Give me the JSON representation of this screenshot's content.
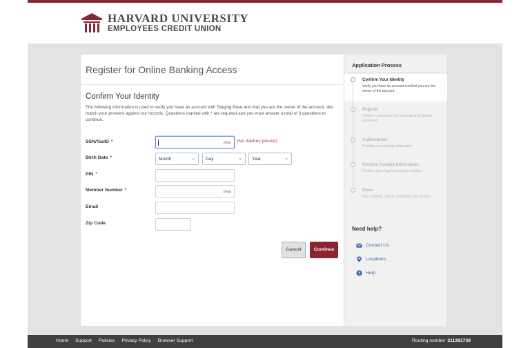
{
  "brand": {
    "line1": "HARVARD UNIVERSITY",
    "line2": "EMPLOYEES CREDIT UNION",
    "accent": "#8c2432"
  },
  "form": {
    "title": "Register for Online Banking Access",
    "section_title": "Confirm Your Identity",
    "intro": "The following information is used to verify you have an account with Staging Base and that you are the owner of the account. We match your answers against our records. Questions marked with * are required and you must answer a total of 3 questions to continue.",
    "ssn_label": "SSN/TaxID",
    "ssn_hint": "(No dashes please)",
    "birth_label": "Birth Date",
    "month": "Month",
    "day": "Day",
    "year": "Year",
    "pin_label": "PIN",
    "member_label": "Member Number",
    "email_label": "Email",
    "zip_label": "Zip Code",
    "show": "show",
    "required_mark": "*",
    "cancel": "Cancel",
    "continue": "Continue"
  },
  "process": {
    "title": "Application Process",
    "steps": [
      {
        "name": "Confirm Your Identity",
        "desc": "Verify you have an account and that you are the owner of the account.",
        "active": true
      },
      {
        "name": "Register",
        "desc": "Create a username and generate a temporary password.",
        "active": false
      },
      {
        "name": "Authenticate",
        "desc": "Provide your security information.",
        "active": false
      },
      {
        "name": "Confirm Contact Information",
        "desc": "Confirm your email and phone number.",
        "active": false
      },
      {
        "name": "Done",
        "desc": "Start banking, saving, budgeting and sharing.",
        "active": false
      }
    ]
  },
  "help": {
    "title": "Need help?",
    "contact": "Contact Us",
    "locations": "Locations",
    "help": "Help",
    "icons": [
      "envelope-icon",
      "map-pin-icon",
      "question-icon"
    ],
    "icon_color": "#3f63a8"
  },
  "footer": {
    "links": [
      "Home",
      "Support",
      "Policies",
      "Privacy Policy",
      "Browser Support"
    ],
    "routing_label": "Routing number",
    "routing_number": "211381738"
  }
}
